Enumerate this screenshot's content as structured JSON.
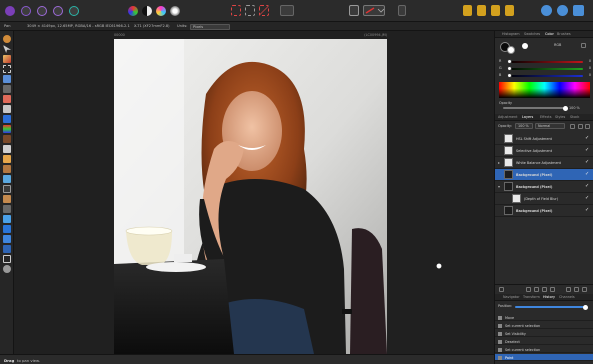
{
  "context_bar": {
    "tool": "Pan",
    "doc_info": "3049 × 4149px, 12.65MP, RGBA/16 - sRGB IEC61966-2.1",
    "camera": "X-T1 (XF27mmF2.8)",
    "units_label": "Units:",
    "units_value": "Pixels"
  },
  "canvas": {
    "doc_ruler_left": "00000",
    "doc_ruler_right": "(LC00994.JM)"
  },
  "status": {
    "bold": "Drag",
    "rest": "to pan view."
  },
  "panel": {
    "top_tabs": [
      "Histogram",
      "Swatches",
      "Color",
      "Brushes"
    ],
    "active_top_tab": "Color",
    "color_model": "RGB",
    "opacity_label": "Opacity",
    "opacity_value": "100 %",
    "layer_tabs": [
      "Adjustment",
      "Layers",
      "Effects",
      "Styles",
      "Stock"
    ],
    "active_layer_tab": "Layers",
    "layer_opacity_label": "Opacity:",
    "layer_opacity_value": "100 %",
    "blend_mode": "Normal",
    "layers": [
      {
        "label": "HSL Shift Adjustment",
        "indent": 0,
        "selected": false,
        "arrow": ""
      },
      {
        "label": "Selective Adjustment",
        "indent": 0,
        "selected": false,
        "arrow": ""
      },
      {
        "label": "White Balance Adjustment",
        "indent": 0,
        "selected": false,
        "arrow": "▸"
      },
      {
        "label": "Background (Pixel)",
        "indent": 0,
        "selected": true,
        "arrow": ""
      },
      {
        "label": "Background (Pixel)",
        "indent": 0,
        "selected": false,
        "arrow": "▾"
      },
      {
        "label": "(Depth of Field Blur)",
        "indent": 8,
        "selected": false,
        "arrow": ""
      },
      {
        "label": "Background (Pixel)",
        "indent": 0,
        "selected": false,
        "arrow": ""
      }
    ],
    "bottom_tabs": [
      "Navigator",
      "Transform",
      "History",
      "Channels"
    ],
    "active_bottom_tab": "History",
    "position_label": "Position:",
    "history": [
      {
        "label": "Move",
        "selected": false
      },
      {
        "label": "Set current selection",
        "selected": false
      },
      {
        "label": "Set Visibility",
        "selected": false
      },
      {
        "label": "Deselect",
        "selected": false
      },
      {
        "label": "Set current selection",
        "selected": false
      },
      {
        "label": "Paint",
        "selected": true
      }
    ]
  },
  "colors": {
    "selection_blue": "#2f65b5",
    "red_track": "#c0141b",
    "green_track": "#1fa31f",
    "blue_track": "#1c2fd0"
  }
}
